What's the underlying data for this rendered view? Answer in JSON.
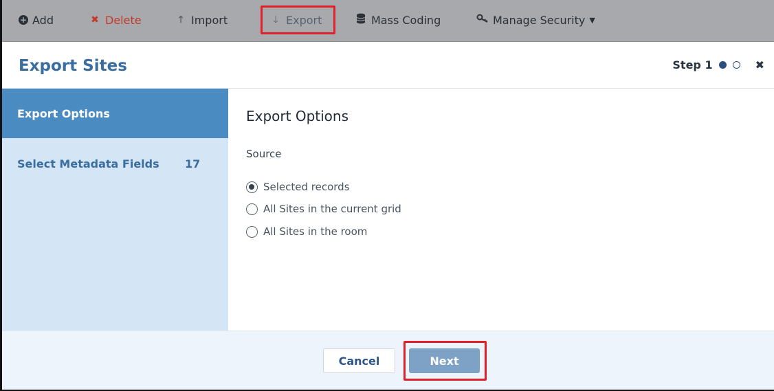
{
  "toolbar": {
    "add": "Add",
    "delete": "Delete",
    "import": "Import",
    "export": "Export",
    "mass_coding": "Mass Coding",
    "manage_security": "Manage Security"
  },
  "dialog": {
    "title": "Export Sites",
    "step_label": "Step 1"
  },
  "sidebar": {
    "items": [
      {
        "label": "Export Options"
      },
      {
        "label": "Select Metadata Fields",
        "count": "17"
      }
    ]
  },
  "main": {
    "section_title": "Export Options",
    "source_label": "Source",
    "options": [
      {
        "label": "Selected records",
        "checked": true
      },
      {
        "label": "All Sites in the current grid",
        "checked": false
      },
      {
        "label": "All Sites in the room",
        "checked": false
      }
    ]
  },
  "footer": {
    "cancel": "Cancel",
    "next": "Next"
  },
  "colors": {
    "toolbar_bg": "#a7a9ad",
    "accent": "#3b6ea0",
    "sidebar_active": "#4a8bc2",
    "sidebar_bg": "#d4e6f6",
    "highlight": "#e0202a",
    "delete": "#c0392b"
  }
}
